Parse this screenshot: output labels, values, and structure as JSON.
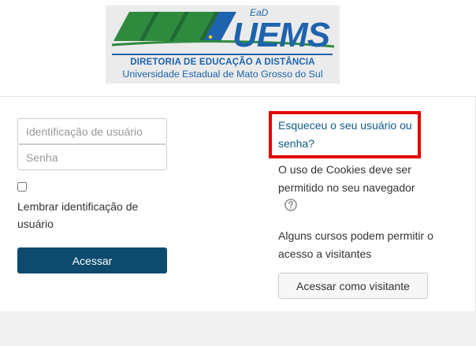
{
  "logo": {
    "ead": "EaD",
    "uems": "UEMS",
    "line1": "DIRETORIA DE EDUCAÇÃO A DISTÂNCIA",
    "line2": "Universidade Estadual de Mato Grosso do Sul",
    "colors": {
      "green": "#2e8b3e",
      "dark_green": "#1f6b33",
      "blue": "#1e63ad",
      "background": "#ebebeb"
    }
  },
  "login": {
    "username_placeholder": "Identificação de usuário",
    "username_value": "",
    "password_placeholder": "Senha",
    "password_value": "",
    "remember_label": "Lembrar identificação de usuário",
    "remember_checked": false,
    "submit_label": "Acessar",
    "submit_color": "#0d4a6d"
  },
  "sidebar": {
    "forgot_link": "Esqueceu o seu usuário ou senha?",
    "highlight_color": "#e30000",
    "cookies_text": "O uso de Cookies deve ser permitido no seu navegador",
    "help_icon": "question-circle-icon",
    "guests_text": "Alguns cursos podem permitir o acesso a visitantes",
    "guest_button_label": "Acessar como visitante"
  }
}
